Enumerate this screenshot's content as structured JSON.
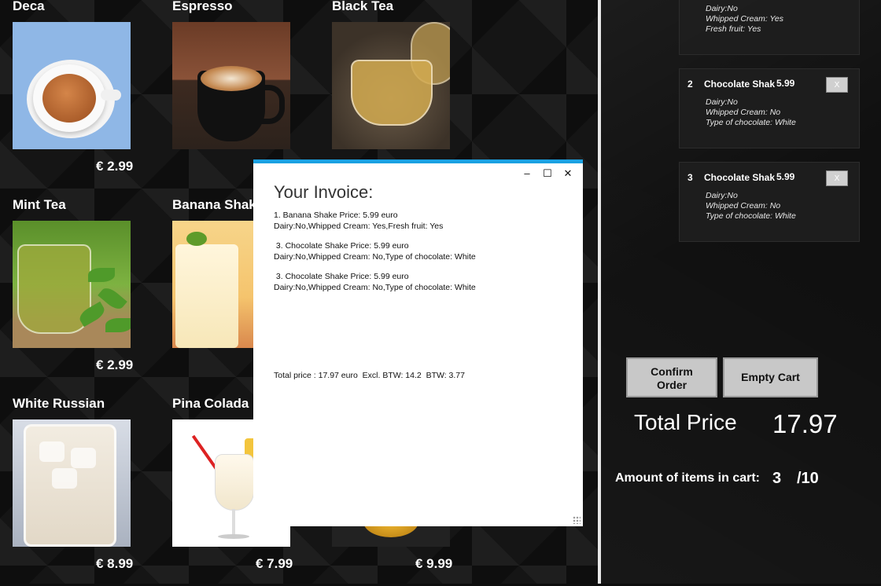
{
  "products": [
    {
      "name": "Deca",
      "price": "€ 2.99"
    },
    {
      "name": "Espresso",
      "price": ""
    },
    {
      "name": "Black Tea",
      "price": ""
    },
    {
      "name": "Mint Tea",
      "price": "€ 2.99"
    },
    {
      "name": "Banana Shak",
      "price": ""
    },
    {
      "name": "White Russian",
      "price": "€ 8.99"
    },
    {
      "name": "Pina Colada",
      "price": "€ 7.99"
    },
    {
      "name": "",
      "price": "€ 9.99"
    }
  ],
  "invoice": {
    "title": "Your Invoice:",
    "window_buttons": {
      "minimize": "–",
      "maximize": "☐",
      "close": "✕"
    },
    "entries": [
      {
        "line1": "1. Banana Shake Price: 5.99 euro",
        "line2": "Dairy:No,Whipped Cream: Yes,Fresh fruit: Yes"
      },
      {
        "line1": " 3. Chocolate Shake Price: 5.99 euro",
        "line2": "Dairy:No,Whipped Cream: No,Type of chocolate: White"
      },
      {
        "line1": " 3. Chocolate Shake Price: 5.99 euro",
        "line2": "Dairy:No,Whipped Cream: No,Type of chocolate: White"
      }
    ],
    "total_line": "Total price : 17.97 euro  Excl. BTW: 14.2  BTW: 3.77"
  },
  "cart": {
    "partial_item": {
      "opts": [
        "Dairy:No",
        "Whipped Cream: Yes",
        "Fresh fruit: Yes"
      ]
    },
    "items": [
      {
        "num": "2",
        "name": "Chocolate Shak",
        "price": "5.99",
        "remove": "X",
        "opts": [
          "Dairy:No",
          "Whipped Cream: No",
          "Type of chocolate: White"
        ]
      },
      {
        "num": "3",
        "name": "Chocolate Shak",
        "price": "5.99",
        "remove": "X",
        "opts": [
          "Dairy:No",
          "Whipped Cream: No",
          "Type of chocolate: White"
        ]
      }
    ],
    "confirm_label": "Confirm Order",
    "empty_label": "Empty Cart",
    "total_label": "Total Price",
    "total_value": "17.97",
    "amount_label": "Amount of items in cart:",
    "amount_value": "3",
    "amount_max": "/10"
  },
  "colors": {
    "accent": "#1ba1e2",
    "button": "#c8c8c8"
  }
}
